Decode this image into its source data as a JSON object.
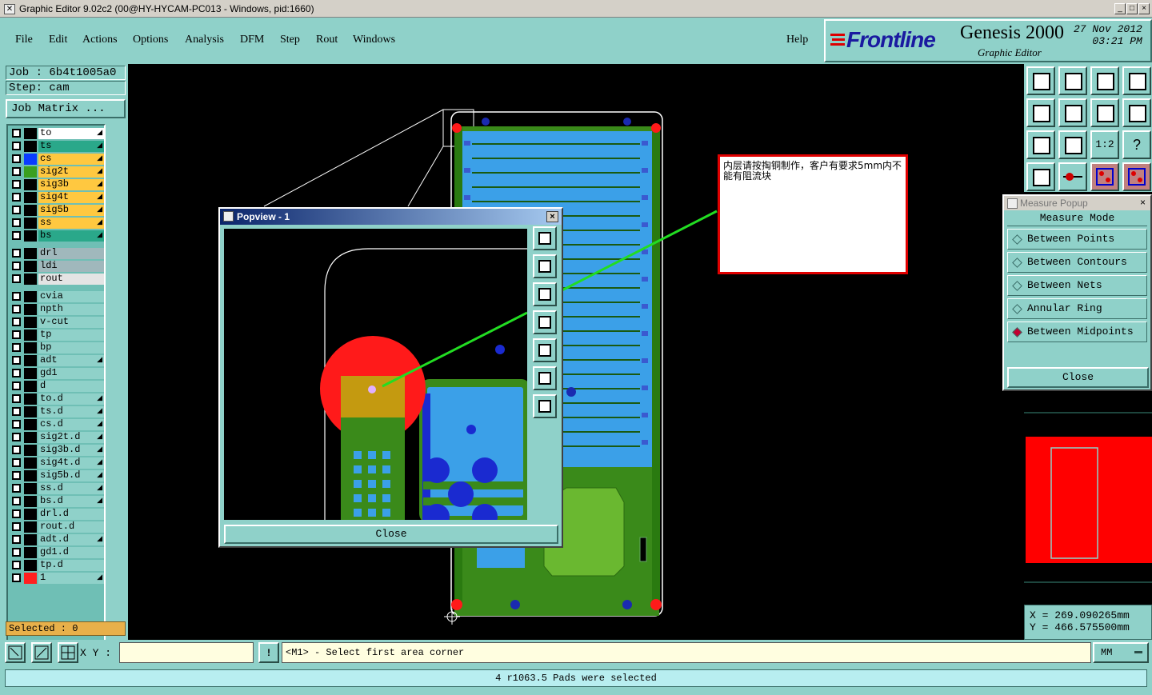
{
  "window": {
    "title": "Graphic Editor 9.02c2 (00@HY-HYCAM-PC013 - Windows, pid:1660)"
  },
  "menu": {
    "file": "File",
    "edit": "Edit",
    "actions": "Actions",
    "options": "Options",
    "analysis": "Analysis",
    "dfm": "DFM",
    "step": "Step",
    "rout": "Rout",
    "windows": "Windows",
    "help": "Help"
  },
  "brand": {
    "logo": "Frontline",
    "product": "Genesis 2000",
    "subtitle": "Graphic Editor",
    "date": "27 Nov 2012",
    "time": "03:21 PM"
  },
  "job": {
    "job_line": "Job : 6b4t1005a0",
    "step_line": "Step: cam",
    "matrix_button": "Job Matrix ..."
  },
  "layers": [
    {
      "name": "to",
      "swatch": "#000000",
      "bg": "#ffffff",
      "editable": true
    },
    {
      "name": "ts",
      "swatch": "#000000",
      "bg": "#2aa88a",
      "editable": true
    },
    {
      "name": "cs",
      "swatch": "#0a3cff",
      "bg": "#ffc840",
      "editable": true
    },
    {
      "name": "sig2t",
      "swatch": "#3aa020",
      "bg": "#ffc840",
      "editable": true
    },
    {
      "name": "sig3b",
      "swatch": "#000000",
      "bg": "#ffc840",
      "editable": true
    },
    {
      "name": "sig4t",
      "swatch": "#000000",
      "bg": "#ffc840",
      "editable": true
    },
    {
      "name": "sig5b",
      "swatch": "#000000",
      "bg": "#ffc840",
      "editable": true
    },
    {
      "name": "ss",
      "swatch": "#000000",
      "bg": "#ffc840",
      "editable": true
    },
    {
      "name": "bs",
      "swatch": "#000000",
      "bg": "#2aa88a",
      "editable": true
    },
    {
      "name": "drl",
      "swatch": "#000000",
      "bg": "#a0b8bc",
      "editable": false
    },
    {
      "name": "ldi",
      "swatch": "#000000",
      "bg": "#a0b8bc",
      "editable": false
    },
    {
      "name": "rout",
      "swatch": "#000000",
      "bg": "#e4e4e4",
      "editable": false
    },
    {
      "name": "cvia",
      "swatch": "#000000",
      "bg": "#8fd1c9",
      "editable": false
    },
    {
      "name": "npth",
      "swatch": "#000000",
      "bg": "#8fd1c9",
      "editable": false
    },
    {
      "name": "v-cut",
      "swatch": "#000000",
      "bg": "#8fd1c9",
      "editable": false
    },
    {
      "name": "tp",
      "swatch": "#000000",
      "bg": "#8fd1c9",
      "editable": false
    },
    {
      "name": "bp",
      "swatch": "#000000",
      "bg": "#8fd1c9",
      "editable": false
    },
    {
      "name": "adt",
      "swatch": "#000000",
      "bg": "#8fd1c9",
      "editable": true
    },
    {
      "name": "gd1",
      "swatch": "#000000",
      "bg": "#8fd1c9",
      "editable": false
    },
    {
      "name": "d",
      "swatch": "#000000",
      "bg": "#8fd1c9",
      "editable": false
    },
    {
      "name": "to.d",
      "swatch": "#000000",
      "bg": "#8fd1c9",
      "editable": true
    },
    {
      "name": "ts.d",
      "swatch": "#000000",
      "bg": "#8fd1c9",
      "editable": true
    },
    {
      "name": "cs.d",
      "swatch": "#000000",
      "bg": "#8fd1c9",
      "editable": true
    },
    {
      "name": "sig2t.d",
      "swatch": "#000000",
      "bg": "#8fd1c9",
      "editable": true
    },
    {
      "name": "sig3b.d",
      "swatch": "#000000",
      "bg": "#8fd1c9",
      "editable": true
    },
    {
      "name": "sig4t.d",
      "swatch": "#000000",
      "bg": "#8fd1c9",
      "editable": true
    },
    {
      "name": "sig5b.d",
      "swatch": "#000000",
      "bg": "#8fd1c9",
      "editable": true
    },
    {
      "name": "ss.d",
      "swatch": "#000000",
      "bg": "#8fd1c9",
      "editable": true
    },
    {
      "name": "bs.d",
      "swatch": "#000000",
      "bg": "#8fd1c9",
      "editable": true
    },
    {
      "name": "drl.d",
      "swatch": "#000000",
      "bg": "#8fd1c9",
      "editable": false
    },
    {
      "name": "rout.d",
      "swatch": "#000000",
      "bg": "#8fd1c9",
      "editable": false
    },
    {
      "name": "adt.d",
      "swatch": "#000000",
      "bg": "#8fd1c9",
      "editable": true
    },
    {
      "name": "gd1.d",
      "swatch": "#000000",
      "bg": "#8fd1c9",
      "editable": false
    },
    {
      "name": "tp.d",
      "swatch": "#000000",
      "bg": "#8fd1c9",
      "editable": false
    },
    {
      "name": "1",
      "swatch": "#ff2020",
      "bg": "#8fd1c9",
      "editable": true
    }
  ],
  "selected_label": "Selected : 0",
  "popview": {
    "title": "Popview - 1",
    "close": "Close"
  },
  "note": {
    "text": "内层请按掏铜制作，客户有要求5mm内不能有阻流块"
  },
  "measure": {
    "title": "Measure Popup",
    "header": "Measure Mode",
    "options": [
      "Between Points",
      "Between Contours",
      "Between Nets",
      "Annular Ring",
      "Between Midpoints"
    ],
    "active_index": 4,
    "close": "Close"
  },
  "coords": {
    "x": "X = 269.090265mm",
    "y": "Y = 466.575500mm"
  },
  "bottom": {
    "xy_label": "X Y :",
    "xy_value": "",
    "prompt": "<M1> - Select first area corner",
    "units": "MM"
  },
  "status": "4 r1063.5 Pads were selected",
  "tools": {
    "ratio_label": "1:2",
    "help_label": "?"
  }
}
